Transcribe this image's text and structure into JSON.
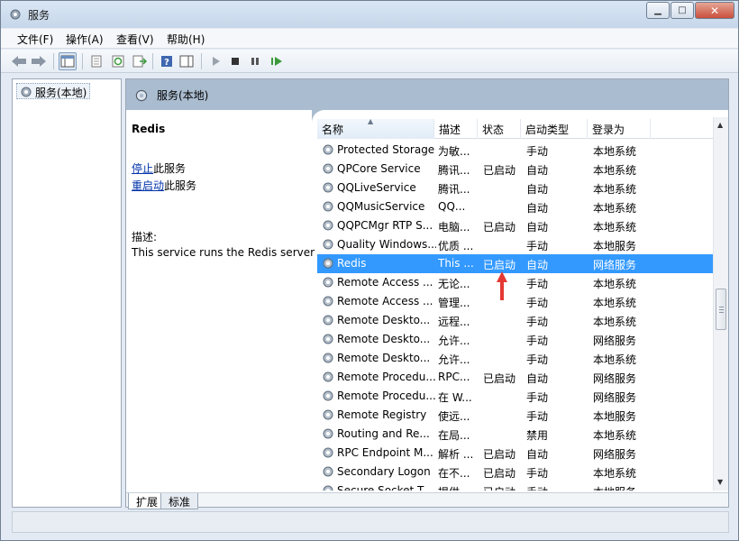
{
  "window": {
    "title": "服务"
  },
  "menu": [
    "文件(F)",
    "操作(A)",
    "查看(V)",
    "帮助(H)"
  ],
  "tree": {
    "root": "服务(本地)"
  },
  "right_header": {
    "title": "服务(本地)"
  },
  "details": {
    "service_name": "Redis",
    "stop_link": "停止",
    "stop_suffix": "此服务",
    "restart_link": "重启动",
    "restart_suffix": "此服务",
    "description_label": "描述:",
    "description_text": "This service runs the Redis server"
  },
  "columns": {
    "name": "名称",
    "description": "描述",
    "status": "状态",
    "startup": "启动类型",
    "logon": "登录为"
  },
  "rows": [
    {
      "name": "Protected Storage",
      "description": "为敏...",
      "status": "",
      "startup": "手动",
      "logon": "本地系统"
    },
    {
      "name": "QPCore Service",
      "description": "腾讯...",
      "status": "已启动",
      "startup": "自动",
      "logon": "本地系统"
    },
    {
      "name": "QQLiveService",
      "description": "腾讯...",
      "status": "",
      "startup": "自动",
      "logon": "本地系统"
    },
    {
      "name": "QQMusicService",
      "description": "QQ...",
      "status": "",
      "startup": "自动",
      "logon": "本地系统"
    },
    {
      "name": "QQPCMgr RTP S...",
      "description": "电脑...",
      "status": "已启动",
      "startup": "自动",
      "logon": "本地系统"
    },
    {
      "name": "Quality Windows...",
      "description": "优质 ...",
      "status": "",
      "startup": "手动",
      "logon": "本地服务"
    },
    {
      "name": "Redis",
      "description": "This ...",
      "status": "已启动",
      "startup": "自动",
      "logon": "网络服务",
      "selected": true
    },
    {
      "name": "Remote Access ...",
      "description": "无论...",
      "status": "",
      "startup": "手动",
      "logon": "本地系统"
    },
    {
      "name": "Remote Access ...",
      "description": "管理...",
      "status": "",
      "startup": "手动",
      "logon": "本地系统"
    },
    {
      "name": "Remote Deskto...",
      "description": "远程...",
      "status": "",
      "startup": "手动",
      "logon": "本地系统"
    },
    {
      "name": "Remote Deskto...",
      "description": "允许...",
      "status": "",
      "startup": "手动",
      "logon": "网络服务"
    },
    {
      "name": "Remote Deskto...",
      "description": "允许...",
      "status": "",
      "startup": "手动",
      "logon": "本地系统"
    },
    {
      "name": "Remote Procedu...",
      "description": "RPC...",
      "status": "已启动",
      "startup": "自动",
      "logon": "网络服务"
    },
    {
      "name": "Remote Procedu...",
      "description": "在 W...",
      "status": "",
      "startup": "手动",
      "logon": "网络服务"
    },
    {
      "name": "Remote Registry",
      "description": "使远...",
      "status": "",
      "startup": "手动",
      "logon": "本地服务"
    },
    {
      "name": "Routing and Re...",
      "description": "在局...",
      "status": "",
      "startup": "禁用",
      "logon": "本地系统"
    },
    {
      "name": "RPC Endpoint M...",
      "description": "解析 ...",
      "status": "已启动",
      "startup": "自动",
      "logon": "网络服务"
    },
    {
      "name": "Secondary Logon",
      "description": "在不...",
      "status": "已启动",
      "startup": "手动",
      "logon": "本地系统"
    },
    {
      "name": "Secure Socket T...",
      "description": "提供...",
      "status": "已启动",
      "startup": "手动",
      "logon": "本地服务"
    }
  ],
  "tabs": [
    "扩展",
    "标准"
  ],
  "colors": {
    "selection": "#3399ff",
    "arrow": "#e53935",
    "link": "#0033aa",
    "header_band": "#aabccf"
  }
}
